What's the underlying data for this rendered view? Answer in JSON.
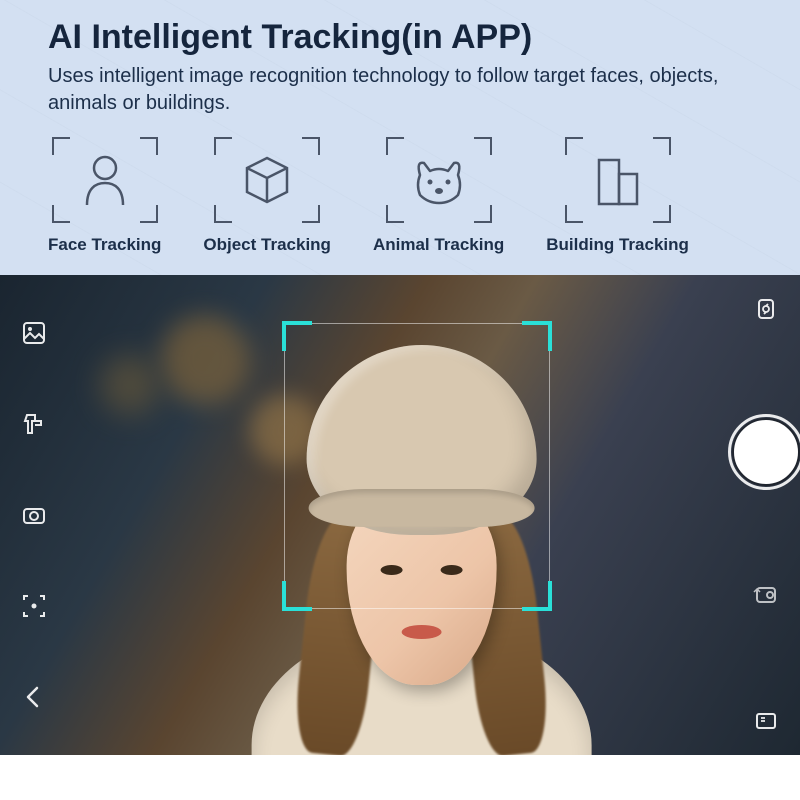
{
  "header": {
    "title": "AI Intelligent Tracking(in APP)",
    "subtitle": "Uses intelligent image recognition technology to follow target faces, objects, animals or buildings."
  },
  "features": [
    {
      "icon": "person-icon",
      "label": "Face Tracking"
    },
    {
      "icon": "cube-icon",
      "label": "Object Tracking"
    },
    {
      "icon": "dog-icon",
      "label": "Animal Tracking"
    },
    {
      "icon": "building-icon",
      "label": "Building Tracking"
    }
  ],
  "camera": {
    "left_controls": [
      {
        "name": "gallery-icon"
      },
      {
        "name": "gimbal-mode-icon"
      },
      {
        "name": "settings-camera-icon"
      },
      {
        "name": "focus-mode-icon"
      },
      {
        "name": "back-icon"
      }
    ],
    "right_controls": [
      {
        "name": "rotate-icon"
      },
      {
        "name": "shutter-button"
      },
      {
        "name": "switch-camera-icon"
      },
      {
        "name": "fullscreen-icon"
      }
    ],
    "tracking_target": "face",
    "tracking_color": "#2ae0d8"
  }
}
